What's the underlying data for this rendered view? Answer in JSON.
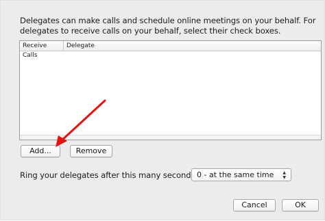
{
  "dialog": {
    "description": "Delegates can make calls and schedule online meetings on your behalf. For delegates to receive calls on your behalf, select their check boxes.",
    "table": {
      "columns": [
        "Receive Calls",
        "Delegate"
      ],
      "rows": []
    },
    "buttons": {
      "add": "Add...",
      "remove": "Remove",
      "cancel": "Cancel",
      "ok": "OK"
    },
    "ring": {
      "label": "Ring your delegates after this many seconds:",
      "selected": "0 - at the same time",
      "arrow_icon": "up-down-arrows-icon"
    }
  },
  "annotation": {
    "arrow_icon": "red-arrow-icon",
    "color": "#e3130f"
  }
}
